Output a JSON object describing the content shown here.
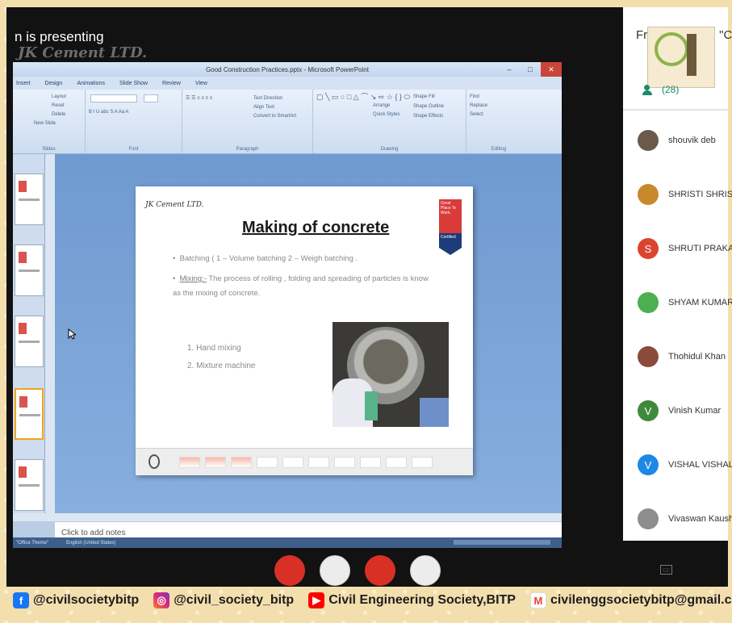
{
  "meeting": {
    "presenting_label": "n is presenting",
    "brand_watermark": "JK Cement LTD."
  },
  "ppt": {
    "window_title": "Good Construction Practices.pptx - Microsoft PowerPoint",
    "window_controls": [
      "–",
      "□",
      "✕"
    ],
    "ribbon_tabs": [
      "Insert",
      "Design",
      "Animations",
      "Slide Show",
      "Review",
      "View"
    ],
    "groups": [
      "Slides",
      "Font",
      "Paragraph",
      "Drawing",
      "Editing"
    ],
    "slides_group": [
      "Layout",
      "Reset",
      "Delete",
      "New Slide"
    ],
    "paragraph_group": [
      "Text Direction",
      "Align Text",
      "Convert to SmartArt"
    ],
    "drawing_group": [
      "Shape Fill",
      "Shape Outline",
      "Shape Effects",
      "Arrange",
      "Quick Styles"
    ],
    "editing_group": [
      "Find",
      "Replace",
      "Select"
    ],
    "slide": {
      "logo_text": "JK Cement LTD.",
      "title": "Making of concrete",
      "badge_top": "Great Place To Work.",
      "badge_bottom": "Certified",
      "bullet1": "Batching ( 1 – Volume batching  2 – Weigh batching .",
      "bullet2_label": "Mixing:-",
      "bullet2_text": " The process of rolling , folding and spreading of particles is know as the mixing of concrete.",
      "list": [
        "1.   Hand mixing",
        "2.   Mixture machine"
      ]
    },
    "notes_placeholder": "Click to add notes",
    "status_theme": "\"Office Theme\"",
    "status_language": "English (United States)"
  },
  "participants": {
    "panel_title": "From \"Civil\" on \"C",
    "count_label": "(28)",
    "people": [
      {
        "name": "shouvik deb",
        "initial": "",
        "color": "#6b5a4a"
      },
      {
        "name": "SHRISTI SHRISTI",
        "initial": "",
        "color": "#c8892a"
      },
      {
        "name": "SHRUTI PRAKASH",
        "initial": "S",
        "color": "#d9462f"
      },
      {
        "name": "SHYAM KUMAR",
        "initial": "",
        "color": "#4caf50"
      },
      {
        "name": "Thohidul Khan",
        "initial": "",
        "color": "#8a4b3a"
      },
      {
        "name": "Vinish Kumar",
        "initial": "V",
        "color": "#3f8a3a"
      },
      {
        "name": "VISHAL VISHAL",
        "initial": "V",
        "color": "#1e88e5"
      },
      {
        "name": "Vivaswan Kaush",
        "initial": "",
        "color": "#8d8d8d"
      }
    ]
  },
  "cc_label": "cc",
  "social": {
    "facebook": "@civilsocietybitp",
    "instagram": "@civil_society_bitp",
    "youtube": "Civil Engineering Society,BITP",
    "gmail": "civilenggsocietybitp@gmail.com"
  }
}
